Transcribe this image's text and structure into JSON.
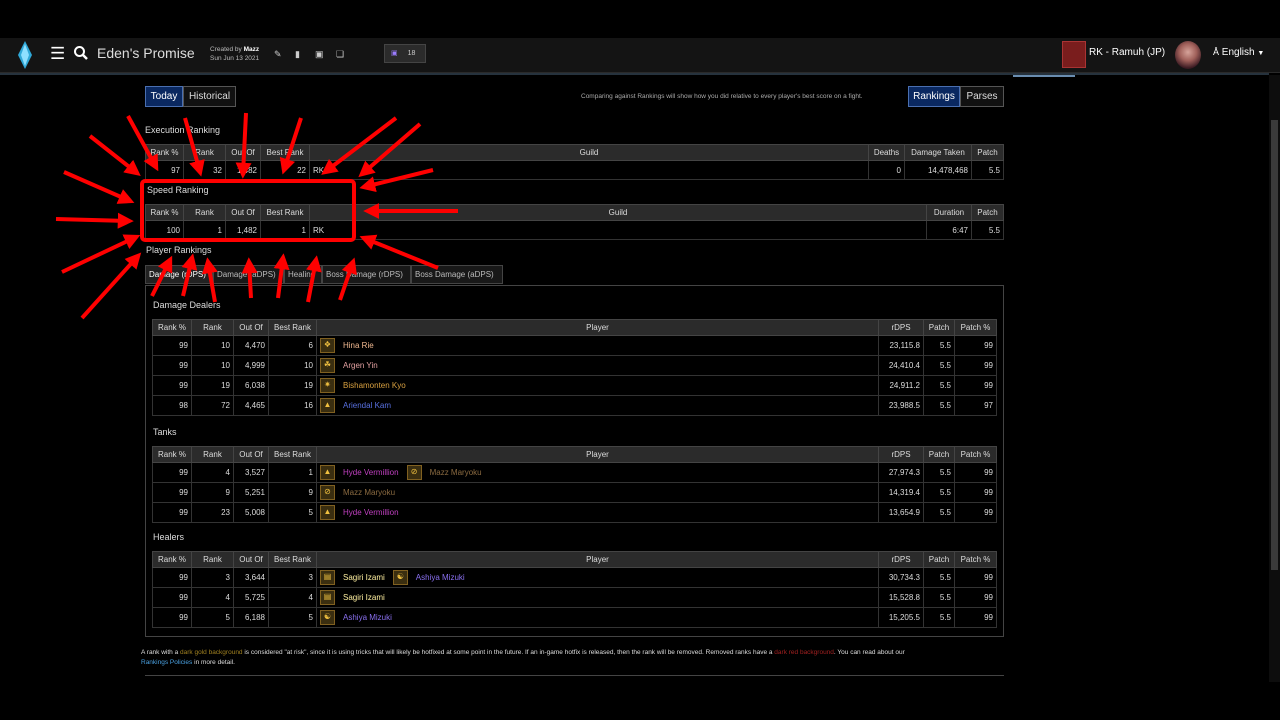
{
  "header": {
    "zone_title": "Eden's Promise",
    "created_by_prefix": "Created by",
    "created_by_name": "Mazz",
    "created_date": "Sun Jun 13 2021",
    "twitch_count": "18",
    "guild": "RK - Ramuh (JP)",
    "language": "English"
  },
  "controls": {
    "today_label": "Today",
    "historical_label": "Historical",
    "comparing_note": "Comparing against Rankings will show how you did relative to every player's best score on a fight.",
    "rankings_label": "Rankings",
    "parses_label": "Parses"
  },
  "execution": {
    "title": "Execution Ranking",
    "headers": [
      "Rank %",
      "Rank",
      "Out Of",
      "Best Rank",
      "Guild",
      "Deaths",
      "Damage Taken",
      "Patch"
    ],
    "row": {
      "rank_pct": "97",
      "rank": "32",
      "out_of": "1,482",
      "best_rank": "22",
      "guild": "RK",
      "deaths": "0",
      "damage_taken": "14,478,468",
      "patch": "5.5"
    }
  },
  "speed": {
    "title": "Speed Ranking",
    "headers": [
      "Rank %",
      "Rank",
      "Out Of",
      "Best Rank",
      "Guild",
      "Duration",
      "Patch"
    ],
    "row": {
      "rank_pct": "100",
      "rank": "1",
      "out_of": "1,482",
      "best_rank": "1",
      "guild": "RK",
      "duration": "6:47",
      "patch": "5.5"
    }
  },
  "player_rankings": {
    "title": "Player Rankings",
    "tabs": [
      "Damage (rDPS)",
      "Damage (aDPS)",
      "Healing",
      "Boss Damage (rDPS)",
      "Boss Damage (aDPS)"
    ],
    "headers": [
      "Rank %",
      "Rank",
      "Out Of",
      "Best Rank",
      "Player",
      "rDPS",
      "Patch",
      "Patch %"
    ],
    "groups": {
      "dps": {
        "title": "Damage Dealers",
        "rows": [
          {
            "rank_pct": "99",
            "rank": "10",
            "out_of": "4,470",
            "best": "6",
            "player": "Hina Rie",
            "rdps": "23,115.8",
            "patch": "5.5",
            "patch_pct": "99"
          },
          {
            "rank_pct": "99",
            "rank": "10",
            "out_of": "4,999",
            "best": "10",
            "player": "Argen Yin",
            "rdps": "24,410.4",
            "patch": "5.5",
            "patch_pct": "99"
          },
          {
            "rank_pct": "99",
            "rank": "19",
            "out_of": "6,038",
            "best": "19",
            "player": "Bishamonten Kyo",
            "rdps": "24,911.2",
            "patch": "5.5",
            "patch_pct": "99"
          },
          {
            "rank_pct": "98",
            "rank": "72",
            "out_of": "4,465",
            "best": "16",
            "player": "Ariendal Kam",
            "rdps": "23,988.5",
            "patch": "5.5",
            "patch_pct": "97"
          }
        ]
      },
      "tanks": {
        "title": "Tanks",
        "rows": [
          {
            "rank_pct": "99",
            "rank": "4",
            "out_of": "3,527",
            "best": "1",
            "player": "Hyde Vermillion",
            "partner": "Mazz Maryoku",
            "rdps": "27,974.3",
            "patch": "5.5",
            "patch_pct": "99"
          },
          {
            "rank_pct": "99",
            "rank": "9",
            "out_of": "5,251",
            "best": "9",
            "player": "Mazz Maryoku",
            "rdps": "14,319.4",
            "patch": "5.5",
            "patch_pct": "99"
          },
          {
            "rank_pct": "99",
            "rank": "23",
            "out_of": "5,008",
            "best": "5",
            "player": "Hyde Vermillion",
            "rdps": "13,654.9",
            "patch": "5.5",
            "patch_pct": "99"
          }
        ]
      },
      "healers": {
        "title": "Healers",
        "rows": [
          {
            "rank_pct": "99",
            "rank": "3",
            "out_of": "3,644",
            "best": "3",
            "player": "Sagiri Izami",
            "partner": "Ashiya Mizuki",
            "rdps": "30,734.3",
            "patch": "5.5",
            "patch_pct": "99"
          },
          {
            "rank_pct": "99",
            "rank": "4",
            "out_of": "5,725",
            "best": "4",
            "player": "Sagiri Izami",
            "rdps": "15,528.8",
            "patch": "5.5",
            "patch_pct": "99"
          },
          {
            "rank_pct": "99",
            "rank": "5",
            "out_of": "6,188",
            "best": "5",
            "player": "Ashiya Mizuki",
            "rdps": "15,205.5",
            "patch": "5.5",
            "patch_pct": "99"
          }
        ]
      }
    }
  },
  "footer": {
    "p1": "A rank with a",
    "gold": "dark gold background",
    "p2": "is considered \"at risk\", since it is using tricks that will likely be hotfixed at some point in the future. If an in-game hotfix is released, then the rank will be removed. Removed ranks have a",
    "red": "dark red background",
    "p3": ". You can read about our",
    "link": "Rankings Policies",
    "p4": "in more detail."
  },
  "icons": {
    "logo": "crystal-logo-icon",
    "menu": "hamburger-icon",
    "search": "search-icon",
    "edit": "pencil-icon",
    "delete": "trash-icon",
    "lock": "lock-icon",
    "copy": "copy-icon",
    "twitch": "twitch-icon",
    "translate": "translate-icon"
  },
  "colors": {
    "highlight_box": "#ff0000",
    "active_button": "#0a2860",
    "rank_orange": "#ff8000",
    "rank_pink": "#e268a8",
    "rank_gold": "#e5cc80"
  }
}
